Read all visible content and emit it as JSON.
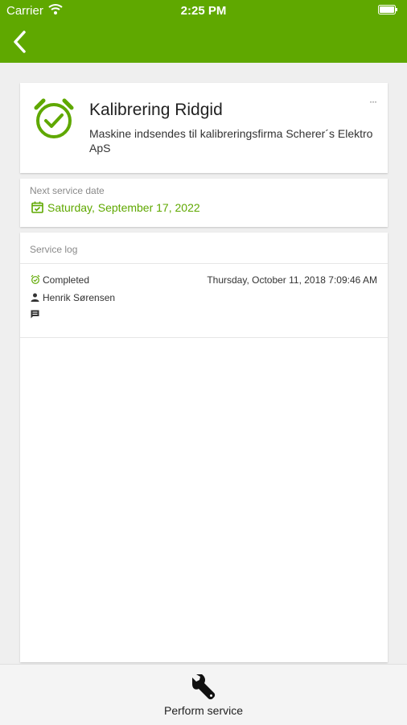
{
  "status_bar": {
    "carrier": "Carrier",
    "time": "2:25 PM"
  },
  "nav": {
    "back_icon": "chevron-left-icon"
  },
  "service": {
    "title": "Kalibrering Ridgid",
    "description": "Maskine indsendes til kalibreringsfirma Scherer´s Elektro ApS",
    "icon": "alarm-clock-check-icon",
    "more_label": "···"
  },
  "next_service": {
    "label": "Next service date",
    "date": "Saturday, September 17, 2022",
    "icon": "calendar-check-icon"
  },
  "service_log": {
    "label": "Service log",
    "entries": [
      {
        "status": "Completed",
        "timestamp": "Thursday, October 11, 2018 7:09:46 AM",
        "user": "Henrik Sørensen"
      }
    ]
  },
  "toolbar": {
    "perform_label": "Perform service",
    "icon": "wrench-icon"
  },
  "colors": {
    "accent": "#5fa800",
    "background": "#efefef",
    "card": "#ffffff"
  }
}
